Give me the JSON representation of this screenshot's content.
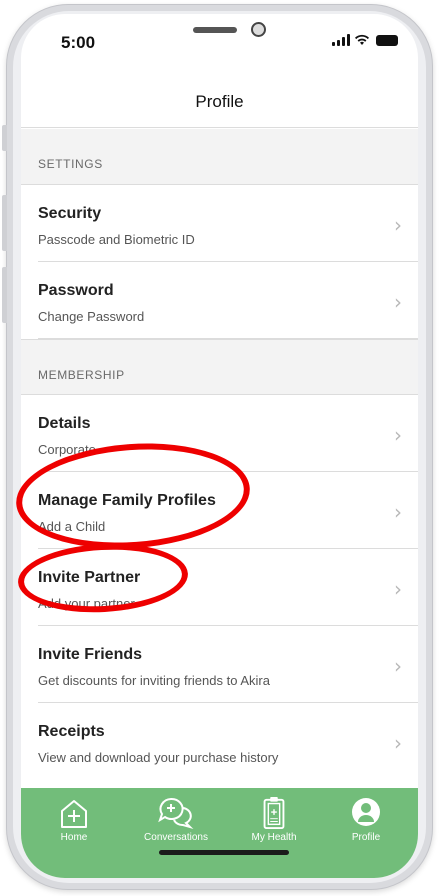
{
  "status_bar": {
    "time": "5:00"
  },
  "header": {
    "title": "Profile"
  },
  "sections": [
    {
      "title": "SETTINGS",
      "items": [
        {
          "title": "Security",
          "subtitle": "Passcode and Biometric ID"
        },
        {
          "title": "Password",
          "subtitle": "Change Password"
        }
      ]
    },
    {
      "title": "MEMBERSHIP",
      "items": [
        {
          "title": "Details",
          "subtitle": "Corporate"
        },
        {
          "title": "Manage Family Profiles",
          "subtitle": "Add a Child"
        },
        {
          "title": "Invite Partner",
          "subtitle": "Add your partner"
        },
        {
          "title": "Invite Friends",
          "subtitle": "Get discounts for inviting friends to Akira"
        },
        {
          "title": "Receipts",
          "subtitle": "View and download your purchase history"
        }
      ]
    }
  ],
  "tabs": [
    {
      "label": "Home",
      "icon": "home-plus-icon"
    },
    {
      "label": "Conversations",
      "icon": "chat-bubbles-icon"
    },
    {
      "label": "My Health",
      "icon": "clipboard-icon"
    },
    {
      "label": "Profile",
      "icon": "person-icon"
    }
  ],
  "colors": {
    "tab_bar": "#72bd7a",
    "annotation": "#ee0000"
  }
}
